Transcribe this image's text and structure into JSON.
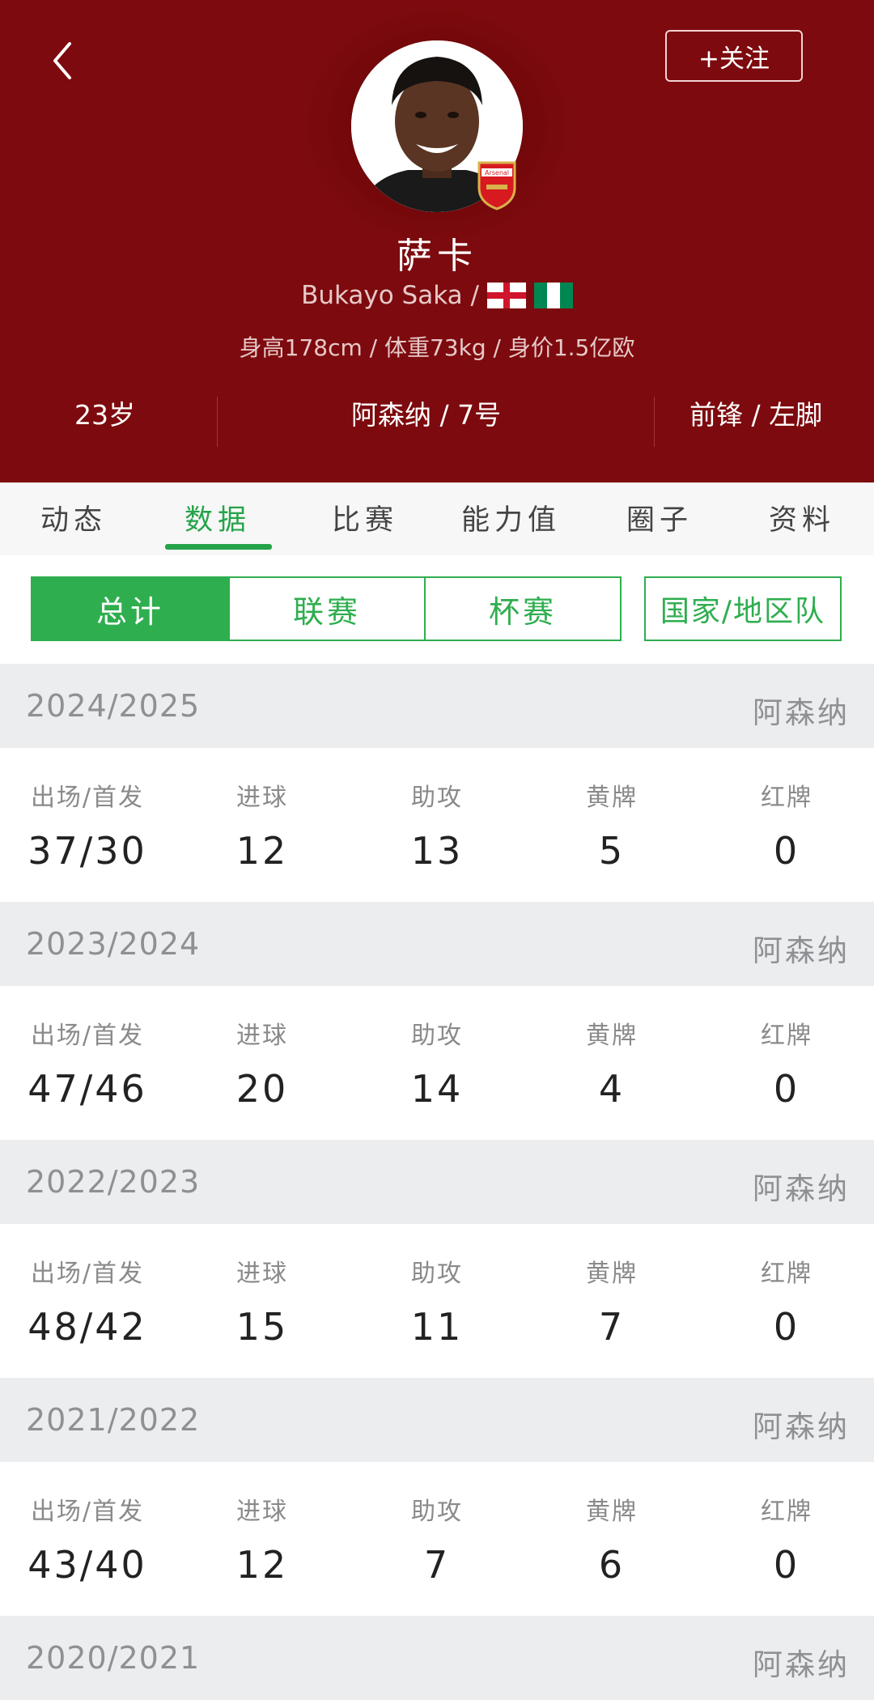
{
  "header": {
    "follow_label": "+关注",
    "player_name": "萨卡",
    "english_name": "Bukayo Saka /",
    "flags": [
      "england-flag",
      "nigeria-flag"
    ],
    "info_line": "身高178cm / 体重73kg / 身价1.5亿欧",
    "age": "23岁",
    "club_number": "阿森纳 / 7号",
    "position_foot": "前锋 / 左脚",
    "badge_text": "Arsenal",
    "colors": {
      "header_bg": "#7d0a0e",
      "accent_green": "#2fae4f"
    }
  },
  "tabs": [
    {
      "label": "动态",
      "active": false
    },
    {
      "label": "数据",
      "active": true
    },
    {
      "label": "比赛",
      "active": false
    },
    {
      "label": "能力值",
      "active": false
    },
    {
      "label": "圈子",
      "active": false
    },
    {
      "label": "资料",
      "active": false
    }
  ],
  "filters": [
    {
      "label": "总计",
      "active": true
    },
    {
      "label": "联赛",
      "active": false
    },
    {
      "label": "杯赛",
      "active": false
    },
    {
      "label": "国家/地区队",
      "active": false
    }
  ],
  "stat_labels": [
    "出场/首发",
    "进球",
    "助攻",
    "黄牌",
    "红牌"
  ],
  "seasons": [
    {
      "year": "2024/2025",
      "club": "阿森纳",
      "values": [
        "37/30",
        "12",
        "13",
        "5",
        "0"
      ]
    },
    {
      "year": "2023/2024",
      "club": "阿森纳",
      "values": [
        "47/46",
        "20",
        "14",
        "4",
        "0"
      ]
    },
    {
      "year": "2022/2023",
      "club": "阿森纳",
      "values": [
        "48/42",
        "15",
        "11",
        "7",
        "0"
      ]
    },
    {
      "year": "2021/2022",
      "club": "阿森纳",
      "values": [
        "43/40",
        "12",
        "7",
        "6",
        "0"
      ]
    },
    {
      "year": "2020/2021",
      "club": "阿森纳"
    }
  ]
}
